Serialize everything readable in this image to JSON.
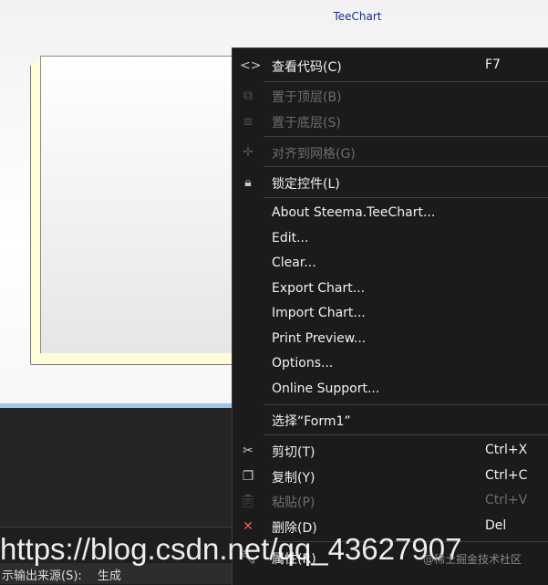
{
  "designer": {
    "title": "TeeChart"
  },
  "menu": {
    "items": [
      {
        "icon": "code-icon",
        "label": "查看代码(C)",
        "shortcut": "F7",
        "enabled": true
      },
      {
        "icon": "bring-to-front-icon",
        "label": "置于顶层(B)",
        "shortcut": "",
        "enabled": false
      },
      {
        "icon": "send-to-back-icon",
        "label": "置于底层(S)",
        "shortcut": "",
        "enabled": false
      },
      {
        "icon": "align-to-grid-icon",
        "label": "对齐到网格(G)",
        "shortcut": "",
        "enabled": false
      },
      {
        "icon": "lock-icon",
        "label": "锁定控件(L)",
        "shortcut": "",
        "enabled": true
      },
      {
        "icon": "",
        "label": "About Steema.TeeChart...",
        "shortcut": "",
        "enabled": true
      },
      {
        "icon": "",
        "label": "Edit...",
        "shortcut": "",
        "enabled": true
      },
      {
        "icon": "",
        "label": "Clear...",
        "shortcut": "",
        "enabled": true
      },
      {
        "icon": "",
        "label": "Export Chart...",
        "shortcut": "",
        "enabled": true
      },
      {
        "icon": "",
        "label": "Import Chart...",
        "shortcut": "",
        "enabled": true
      },
      {
        "icon": "",
        "label": "Print Preview...",
        "shortcut": "",
        "enabled": true
      },
      {
        "icon": "",
        "label": "Options...",
        "shortcut": "",
        "enabled": true
      },
      {
        "icon": "",
        "label": "Online Support...",
        "shortcut": "",
        "enabled": true
      },
      {
        "icon": "",
        "label": "选择“Form1”",
        "shortcut": "",
        "enabled": true
      },
      {
        "icon": "cut-icon",
        "label": "剪切(T)",
        "shortcut": "Ctrl+X",
        "enabled": true
      },
      {
        "icon": "copy-icon",
        "label": "复制(Y)",
        "shortcut": "Ctrl+C",
        "enabled": true
      },
      {
        "icon": "paste-icon",
        "label": "粘贴(P)",
        "shortcut": "Ctrl+V",
        "enabled": false
      },
      {
        "icon": "delete-icon",
        "label": "删除(D)",
        "shortcut": "Del",
        "enabled": true
      },
      {
        "icon": "properties-icon",
        "label": "属性(R)",
        "shortcut": "",
        "enabled": true
      }
    ]
  },
  "output": {
    "label": "示输出来源(S):",
    "value": "生成"
  },
  "watermark": {
    "text": "https://blog.csdn.net/qq_43627907",
    "overlay": "@稀土掘金技术社区"
  }
}
